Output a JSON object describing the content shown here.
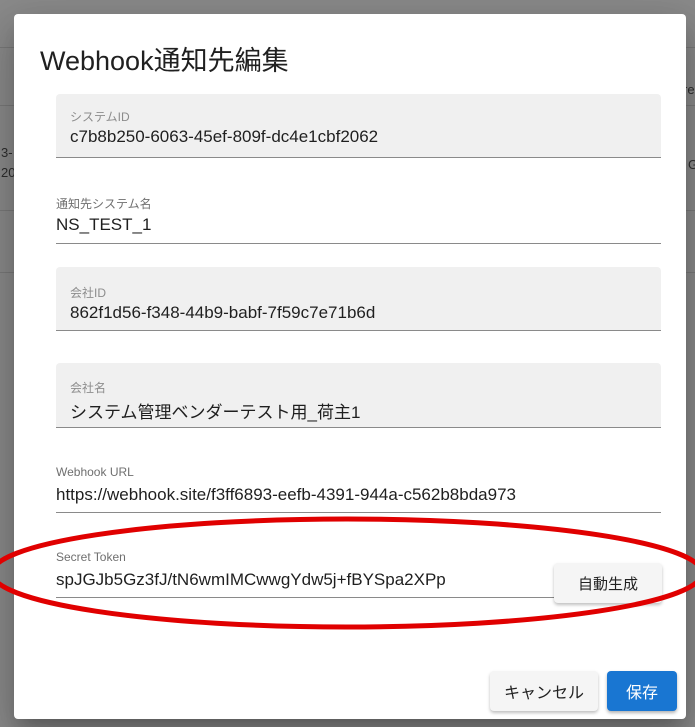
{
  "background": {
    "fragments": [
      "re",
      "3-",
      "20",
      "G"
    ]
  },
  "dialog": {
    "title": "Webhook通知先編集",
    "fields": {
      "system_id": {
        "label": "システムID",
        "value": "c7b8b250-6063-45ef-809f-dc4e1cbf2062"
      },
      "system_name": {
        "label": "通知先システム名",
        "value": "NS_TEST_1"
      },
      "company_id": {
        "label": "会社ID",
        "value": "862f1d56-f348-44b9-babf-7f59c7e71b6d"
      },
      "company_name": {
        "label": "会社名",
        "value": "システム管理ベンダーテスト用_荷主1"
      },
      "webhook_url": {
        "label": "Webhook URL",
        "value": "https://webhook.site/f3ff6893-eefb-4391-944a-c562b8bda973"
      },
      "secret_token": {
        "label": "Secret Token",
        "value": "spJGJb5Gz3fJ/tN6wmIMCwwgYdw5j+fBYSpa2XPp"
      }
    },
    "generate_button": "自動生成",
    "cancel_button": "キャンセル",
    "save_button": "保存"
  },
  "colors": {
    "primary": "#1976d2",
    "annotation": "#e00000"
  }
}
